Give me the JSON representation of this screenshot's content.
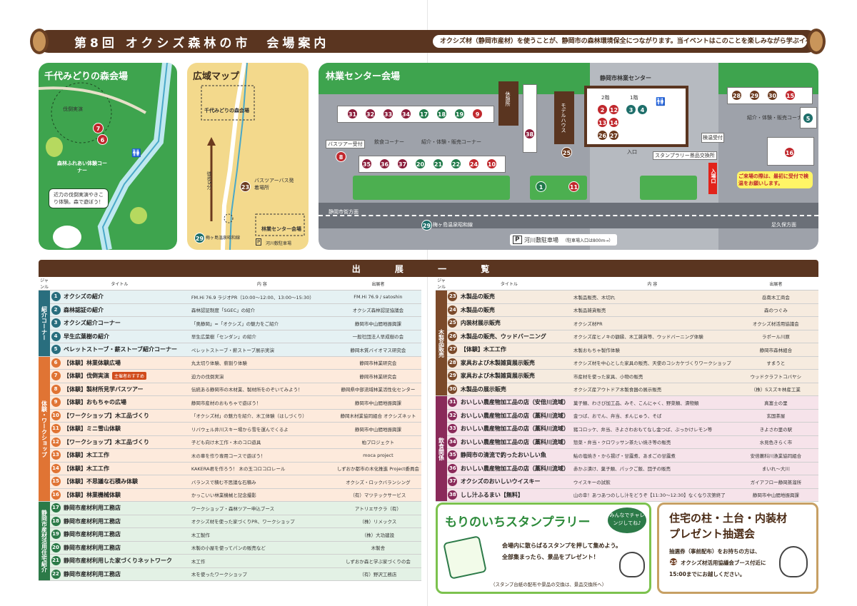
{
  "header": {
    "title": "第8回 オクシズ森林の市　会場案内",
    "subtitle": "オクシズ材（静岡市産材）を使うことが、静岡市の森林環境保全につながります。当イベントはこのことを楽しみながら学ぶイベントです。"
  },
  "map1": {
    "title": "千代みどりの森会場",
    "labels": [
      "伐倒実演",
      "森林ふれあい体験コーナー"
    ],
    "speech": "近力の伐倒実演やきこり体験。森で遊ぼう！",
    "badges": [
      "7",
      "6"
    ]
  },
  "map2": {
    "title": "広域マップ",
    "labels": [
      "千代みどりの森会場",
      "徒歩5分",
      "バスツアーバス発着場所",
      "林業センター会場",
      "梅ヶ島温泉昭和線",
      "河川敷駐車場"
    ],
    "road_no": "29",
    "badge": "23",
    "parking": "P"
  },
  "map3": {
    "title": "林業センター会場",
    "center_title": "静岡市林業センター",
    "floors": [
      "2階",
      "1階"
    ],
    "labels": [
      "休憩所",
      "モデルハウス",
      "バスツアー受付",
      "飲食コーナー",
      "紹介・体験・販売コーナー",
      "紹介・体験・販売コーナー",
      "検温受付",
      "スタンプラリー景品交換所",
      "入口",
      "入場口",
      "静岡市街方面",
      "梅ヶ島温泉昭和線",
      "足久保方面"
    ],
    "parking": "河川敷駐車場",
    "parking_note": "（駐車場入口は800m→）",
    "notice": "ご来場の際は、最初に受付で検温をお願いします。",
    "row1": [
      "31",
      "32",
      "33",
      "34",
      "17",
      "18",
      "19",
      "9"
    ],
    "row2": [
      "35",
      "36",
      "37",
      "20",
      "21",
      "22",
      "24",
      "10"
    ],
    "floor2": [
      "2",
      "12",
      "13",
      "14",
      "26",
      "27"
    ],
    "floor1": [
      "3",
      "4"
    ],
    "right_top": [
      "28",
      "29",
      "30",
      "15"
    ],
    "misc": {
      "b8": "8",
      "b38": "38",
      "b25": "25",
      "b1": "1",
      "b11": "11",
      "b5": "5",
      "b16": "16",
      "road": "29"
    }
  },
  "table": {
    "heading": "出 展 一 覧",
    "headers": {
      "genre": "ジャンル",
      "title": "タイトル",
      "content": "内 容",
      "exhibitor": "出展者"
    },
    "genres": {
      "intro": "紹介コーナー",
      "workshop": "体験・ワークショップ",
      "house": "静岡市産材活用住宅紹介",
      "wood": "木製品販売",
      "food": "飲食関係"
    },
    "recommend": "主催者おすすめ",
    "left_rows": [
      {
        "n": "1",
        "title": "オクシズの紹介",
        "content": "FM.Hi 76.9 ラジオPR（10:00～12:00、13:00～15:30）",
        "ex": "FM.Hi 76.9 / satoshin"
      },
      {
        "n": "2",
        "title": "森林認証の紹介",
        "content": "森林認証制度「SGEC」の紹介",
        "ex": "オクシズ森林認証協議会"
      },
      {
        "n": "3",
        "title": "オクシズ紹介コーナー",
        "content": "「奥静岡」=「オクシズ」の魅力をご紹介",
        "ex": "静岡市中山間地振興課"
      },
      {
        "n": "4",
        "title": "早生広葉樹の紹介",
        "content": "早生広葉樹「センダン」の紹介",
        "ex": "一般社団法人早成樹の会"
      },
      {
        "n": "5",
        "title": "ペレットストーブ・薪ストーブ紹介コーナー",
        "content": "ペレットストーブ・薪ストーブ展示実演",
        "ex": "静岡木質バイオマス研究会"
      },
      {
        "n": "6",
        "title": "【体験】林業体験広場",
        "content": "丸太切り体験、薪割り体験",
        "ex": "静岡市林業研究会"
      },
      {
        "n": "7",
        "title": "【体験】伐倒実演",
        "content": "迫力の伐倒実演",
        "ex": "静岡市林業研究会"
      },
      {
        "n": "8",
        "title": "【体験】製材所見学バスツアー",
        "content": "伝統ある静岡市の木材業、製材所をのぞいてみよう！",
        "ex": "静岡県中部流域林業活性化センター"
      },
      {
        "n": "9",
        "title": "【体験】おもちゃの広場",
        "content": "静岡市産材のおもちゃで遊ぼう！",
        "ex": "静岡市中山間地振興課"
      },
      {
        "n": "10",
        "title": "【ワークショップ】木工品づくり",
        "content": "「オクシズ材」の魅力を紹介、木工体験（はしづくり）",
        "ex": "静岡木材業協同組合 オクシズネット"
      },
      {
        "n": "11",
        "title": "【体験】ミニ雪山体験",
        "content": "リバウェル井川スキー場から雪を運んでくるよ",
        "ex": "静岡市中山間地振興課"
      },
      {
        "n": "12",
        "title": "【ワークショップ】木工品づくり",
        "content": "子ども向け木工作・木のコロ遊具",
        "ex": "柏プロジェクト"
      },
      {
        "n": "13",
        "title": "【体験】木工工作",
        "content": "木の車を作り専用コースで遊ぼう！",
        "ex": "moca project"
      },
      {
        "n": "14",
        "title": "【体験】木工工作",
        "content": "KAKERA君を作ろう！ 木の玉コロコロレール",
        "ex": "しずおか都市の木化推進 Project委員会"
      },
      {
        "n": "15",
        "title": "【体験】不思議な石積み体験",
        "content": "バランスで積む不思議な石積み",
        "ex": "オクシズ・ロックバランシング"
      },
      {
        "n": "16",
        "title": "【体験】林業機械体験",
        "content": "かっこいい林業機械と記念撮影",
        "ex": "（有）マツテックサービス"
      },
      {
        "n": "17",
        "title": "静岡市産材利用工務店",
        "content": "ワークショップ・森林ツアー申込ブース",
        "ex": "アトリエサクラ（有）"
      },
      {
        "n": "18",
        "title": "静岡市産材利用工務店",
        "content": "オクシズ材を使った家づくりPR、ワークショップ",
        "ex": "（株）リメックス"
      },
      {
        "n": "19",
        "title": "静岡市産材利用工務店",
        "content": "木工製作",
        "ex": "（株）大功建設"
      },
      {
        "n": "20",
        "title": "静岡市産材利用工務店",
        "content": "木製の小屋を使ってパンの販売など",
        "ex": "木製舎"
      },
      {
        "n": "21",
        "title": "静岡市産材利用した家づくりネットワーク",
        "content": "木工作",
        "ex": "しずおか森と学ぶ家づくりの会"
      },
      {
        "n": "22",
        "title": "静岡市産材利用工務店",
        "content": "木を使ったワークショップ",
        "ex": "（有）野沢工務店"
      }
    ],
    "right_rows": [
      {
        "n": "23",
        "title": "木製品の販売",
        "content": "木製品販売、木切れ",
        "ex": "岳南木工商会"
      },
      {
        "n": "24",
        "title": "木製品の販売",
        "content": "木製品雑貨販売",
        "ex": "森のつぐみ"
      },
      {
        "n": "25",
        "title": "内装材展示販売",
        "content": "オクシズ材PR",
        "ex": "オクシズ材活用協議会"
      },
      {
        "n": "26",
        "title": "木製品の販売、ウッドバーニング",
        "content": "オクシズ産ヒノキの額縁、木工雑貨等、ウッドバーニング体験",
        "ex": "ラポール川原"
      },
      {
        "n": "27",
        "title": "【体験】木工工作",
        "content": "木製おもちゃ製作体験",
        "ex": "静岡市森林組合"
      },
      {
        "n": "28",
        "title": "家具および木製雑貨展示販売",
        "content": "オクシズ材を中心とした家具の販売、天使のコシカケづくりワークショップ",
        "ex": "すまうと"
      },
      {
        "n": "29",
        "title": "家具および木製雑貨展示販売",
        "content": "市産材を使った家具、小物の販売",
        "ex": "ウッドクラフトコバヤシ"
      },
      {
        "n": "30",
        "title": "木製品の展示販売",
        "content": "オクシズ産アウトドア木製食器の展示販売",
        "ex": "（株）Sスズキ林産工業"
      },
      {
        "n": "31",
        "title": "おいしい農産物加工品の店（安倍川流域）",
        "content": "菓子類、わさび加工品、みそ、こんにゃく、野菜類、漬物類",
        "ex": "真富士の里"
      },
      {
        "n": "32",
        "title": "おいしい農産物加工品の店（藁科川流域）",
        "content": "金つば、おでん、弁当、まんじゅう、そば",
        "ex": "玄国茶屋"
      },
      {
        "n": "33",
        "title": "おいしい農産物加工品の店（藁科川流域）",
        "content": "猪コロッケ、弁当、きよさわおもてなし金つば、ぶっかけレモン等",
        "ex": "きよさわ里の駅"
      },
      {
        "n": "34",
        "title": "おいしい農産物加工品の店（藁科川流域）",
        "content": "惣菜・弁当・クロワッサン茶たい焼き等の販売",
        "ex": "水見色きらく市"
      },
      {
        "n": "35",
        "title": "静岡市の清流で釣ったおいしい魚",
        "content": "鮎の塩焼き・から揚げ・甘露煮、あまごの甘露煮",
        "ex": "安倍藁科川漁業協同組合"
      },
      {
        "n": "36",
        "title": "おいしい農産物加工品の店（藁科川流域）",
        "content": "赤かぶ漬け、菓子類、パックご飯、団子の販売",
        "ex": "まいれ～大川"
      },
      {
        "n": "37",
        "title": "オクシズのおいしいウイスキー",
        "content": "ウイスキーの試飲",
        "ex": "ガイアフロー静岡蒸溜所"
      },
      {
        "n": "38",
        "title": "しし汁ふるまい【無料】",
        "content": "山の幸！あつあつのしし汁をどうぞ【11:30～12:30】なくなり次第終了",
        "ex": "静岡市中山間地振興課"
      }
    ]
  },
  "stamp": {
    "title": "もりのいちスタンプラリー",
    "bubble": "みんなでチャレンジしてね♪",
    "line1": "会場内に散らばるスタンプを押して集めよう。",
    "line2": "全部集まったら、景品をプレゼント！",
    "note": "（スタンプ台紙の配布や景品の交換は、景品交換所へ）"
  },
  "lottery": {
    "title1": "住宅の柱・土台・内装材",
    "title2": "プレゼント抽選会",
    "line1": "抽選券（事前配布）をお持ちの方は、",
    "badge": "25",
    "line2": "オクシズ材活用協議会ブース付近に",
    "line3": "15:00までにお越しください。"
  },
  "colors": {
    "brown": "#5a3520",
    "green": "#3ea44e",
    "red": "#c0282d",
    "maroon": "#8a1c3a",
    "teal": "#1f6f6b"
  }
}
